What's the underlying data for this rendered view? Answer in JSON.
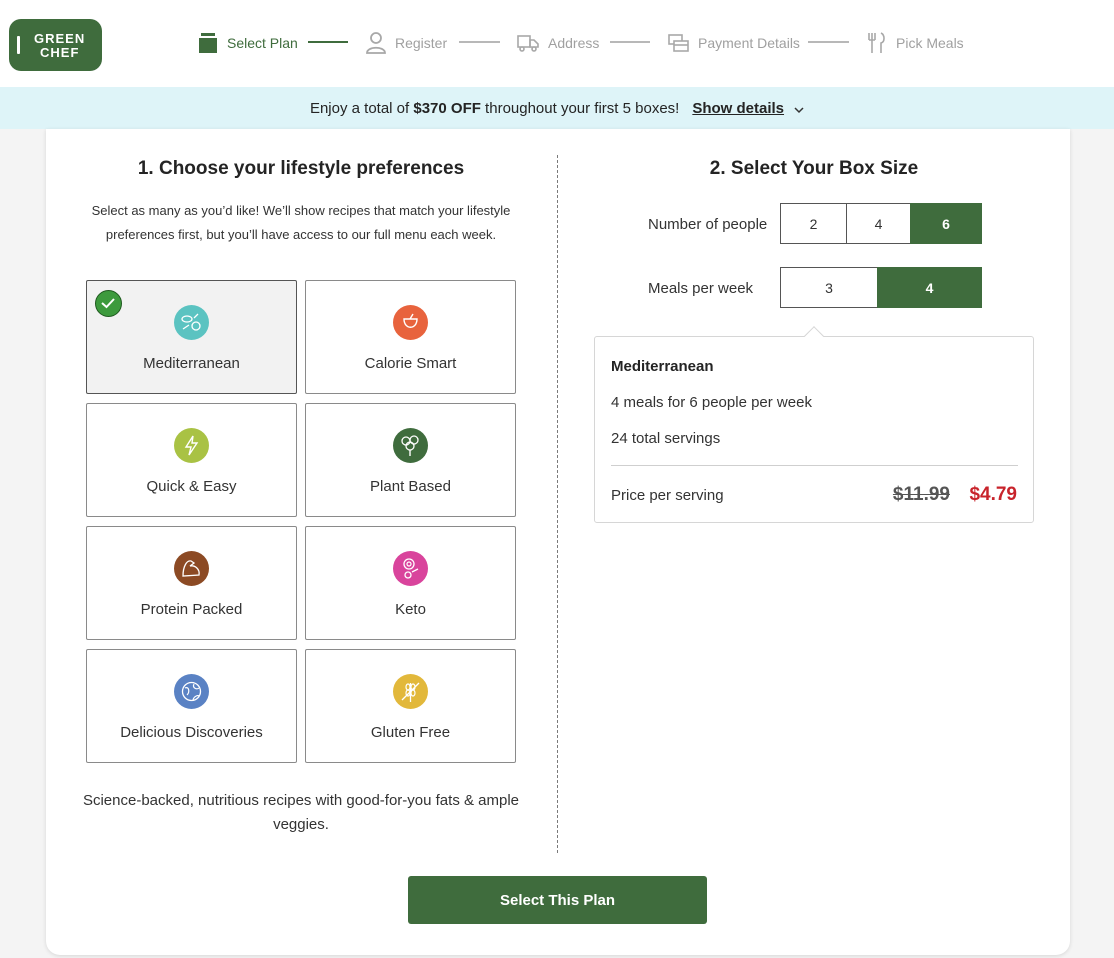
{
  "brand": {
    "line1": "GREEN",
    "line2": "CHEF"
  },
  "steps": [
    {
      "label": "Select Plan",
      "icon": "box-icon",
      "active": true
    },
    {
      "label": "Register",
      "icon": "person-icon",
      "active": false
    },
    {
      "label": "Address",
      "icon": "truck-icon",
      "active": false
    },
    {
      "label": "Payment Details",
      "icon": "card-icon",
      "active": false
    },
    {
      "label": "Pick Meals",
      "icon": "utensils-icon",
      "active": false
    }
  ],
  "promo": {
    "prefix": "Enjoy a total of ",
    "amount": "$370 OFF",
    "suffix": " throughout your first 5 boxes!",
    "link": "Show details"
  },
  "lifestyle": {
    "heading": "1. Choose your lifestyle preferences",
    "subtext": "Select as many as you’d like! We’ll show recipes that match your lifestyle preferences first, but you’ll have access to our full menu each week.",
    "options": [
      {
        "label": "Mediterranean",
        "color": "#5bc3c1",
        "selected": true
      },
      {
        "label": "Calorie Smart",
        "color": "#e8633d",
        "selected": false
      },
      {
        "label": "Quick & Easy",
        "color": "#a9c244",
        "selected": false
      },
      {
        "label": "Plant Based",
        "color": "#3f6c3d",
        "selected": false
      },
      {
        "label": "Protein Packed",
        "color": "#8c4a24",
        "selected": false
      },
      {
        "label": "Keto",
        "color": "#d9449c",
        "selected": false
      },
      {
        "label": "Delicious Discoveries",
        "color": "#5a82c4",
        "selected": false
      },
      {
        "label": "Gluten Free",
        "color": "#e2b83b",
        "selected": false
      }
    ],
    "description": "Science-backed, nutritious recipes with good-for-you fats & ample veggies."
  },
  "box": {
    "heading": "2. Select Your Box Size",
    "people_label": "Number of people",
    "people_options": [
      "2",
      "4",
      "6"
    ],
    "people_selected": "6",
    "meals_label": "Meals per week",
    "meals_options": [
      "3",
      "4"
    ],
    "meals_selected": "4"
  },
  "summary": {
    "title": "Mediterranean",
    "meals_line": "4 meals for 6 people per week",
    "servings_line": "24 total servings",
    "price_label": "Price per serving",
    "old_price": "$11.99",
    "new_price": "$4.79"
  },
  "cta": {
    "label": "Select This Plan"
  },
  "colors": {
    "brand": "#3f6c3d",
    "promo_bg": "#def4f8",
    "sale": "#c8232b"
  }
}
